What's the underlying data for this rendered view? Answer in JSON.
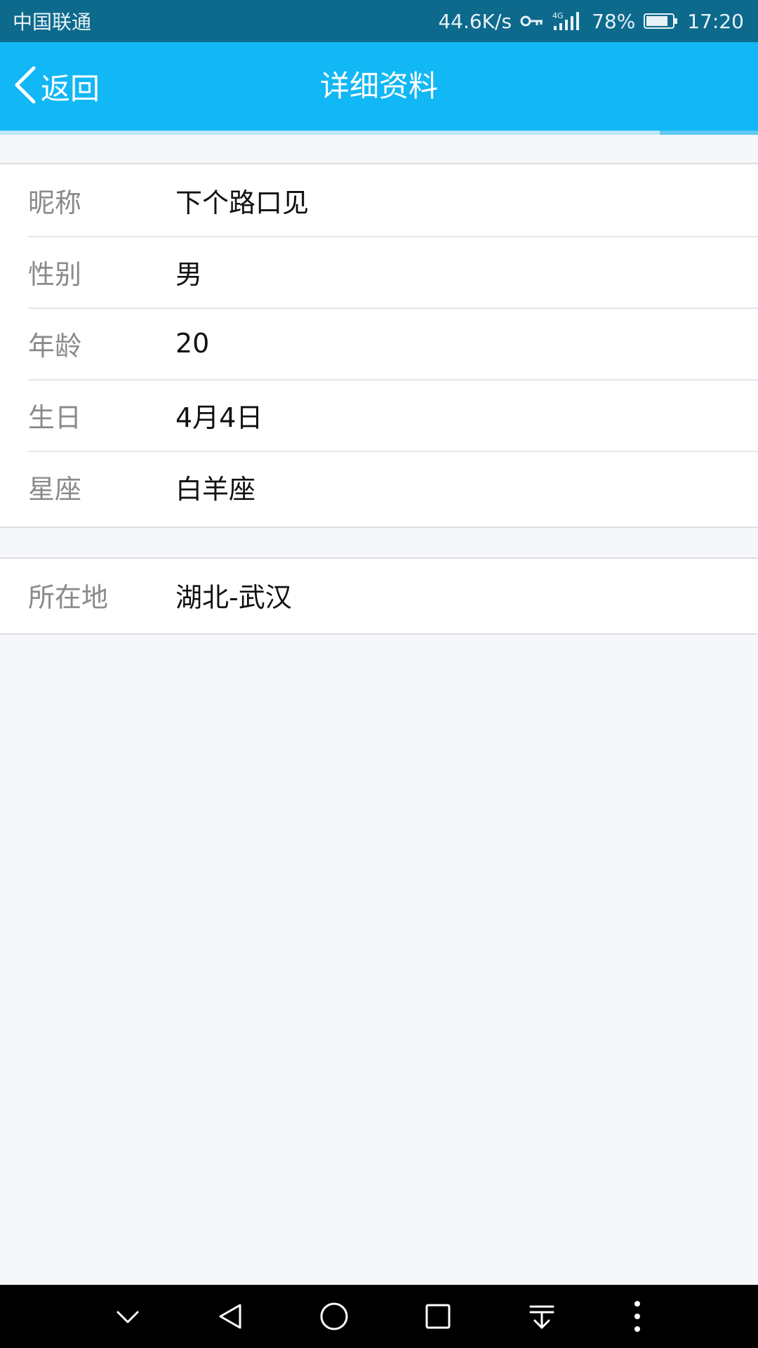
{
  "status_bar": {
    "carrier": "中国联通",
    "speed": "44.6K/s",
    "network": "4G",
    "battery": "78%",
    "time": "17:20"
  },
  "header": {
    "back_label": "返回",
    "title": "详细资料"
  },
  "progress": {
    "fraction": 0.87
  },
  "profile": {
    "rows": [
      {
        "label": "昵称",
        "value": "下个路口见"
      },
      {
        "label": "性别",
        "value": "男"
      },
      {
        "label": "年龄",
        "value": "20"
      },
      {
        "label": "生日",
        "value": "4月4日"
      },
      {
        "label": "星座",
        "value": "白羊座"
      }
    ],
    "location": {
      "label": "所在地",
      "value": "湖北-武汉"
    }
  },
  "colors": {
    "status_bar": "#0d6a8c",
    "nav_bar": "#12b7f5",
    "background": "#f6f7f9"
  },
  "icons": {
    "back": "chevron-left-icon",
    "key": "vpn-key-icon",
    "signal": "signal-4g-icon",
    "battery": "battery-icon",
    "nav": [
      "chevron-down-icon",
      "back-triangle-icon",
      "home-circle-icon",
      "recents-square-icon",
      "notification-pull-icon",
      "more-vertical-icon"
    ]
  }
}
